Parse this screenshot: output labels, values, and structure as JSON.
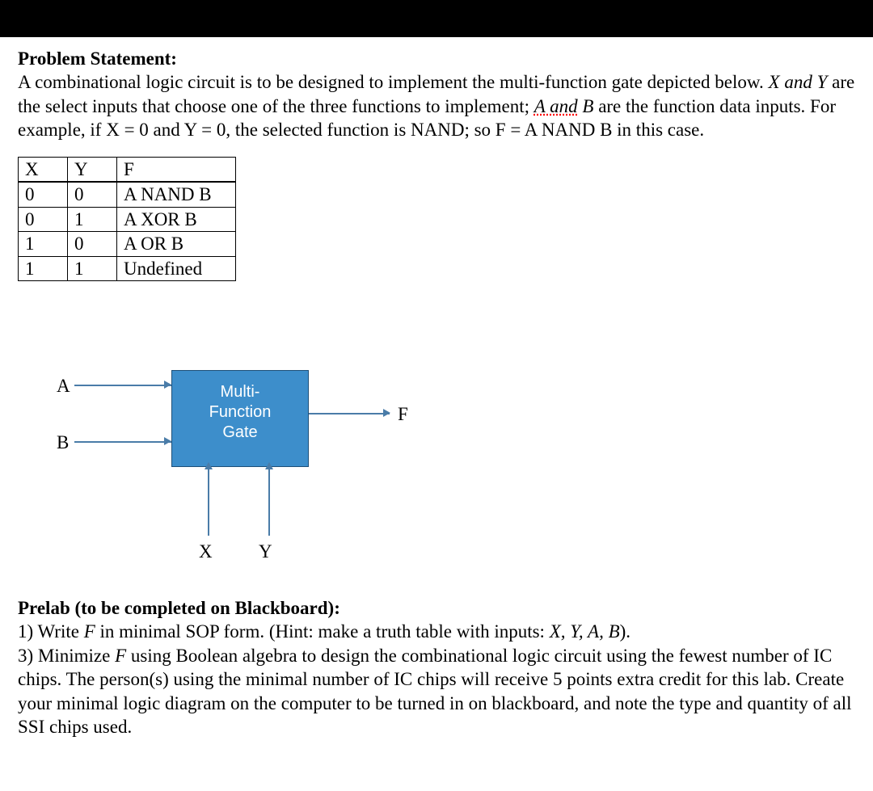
{
  "title": "Problem Statement:",
  "para_before_italic": "A combinational logic circuit is to be designed to implement the multi-function gate depicted below. ",
  "x_and_y": "X and Y",
  "para_mid1": " are the select inputs that choose one of the three functions to implement; ",
  "a_and": "A and",
  "para_mid2": " ",
  "b_italic": "B",
  "para_mid3": " are the function data inputs. For example, if X = 0 and Y = 0, the selected function is NAND; so F = A NAND B in this case.",
  "table": {
    "headers": [
      "X",
      "Y",
      "F"
    ],
    "rows": [
      [
        "0",
        "0",
        "A NAND B"
      ],
      [
        "0",
        "1",
        "A XOR B"
      ],
      [
        "1",
        "0",
        "A OR B"
      ],
      [
        "1",
        "1",
        "Undefined"
      ]
    ]
  },
  "diagram": {
    "gate_line1": "Multi-",
    "gate_line2": "Function",
    "gate_line3": "Gate",
    "A": "A",
    "B": "B",
    "F": "F",
    "X": "X",
    "Y": "Y"
  },
  "prelab_title": "Prelab (to be completed on Blackboard):",
  "prelab_line1a": "1) Write ",
  "prelab_F": "F",
  "prelab_line1b": " in minimal SOP form. (Hint: make a truth table with inputs: ",
  "prelab_inputs": "X, Y, A, B",
  "prelab_line1c": ").",
  "prelab_line2a": "3) Minimize ",
  "prelab_line2b": " using Boolean algebra to design the combinational logic circuit using the fewest number of IC chips. The person(s) using the minimal number of IC chips will receive 5 points extra credit for this lab. Create your minimal logic diagram on the computer to be turned in on blackboard, and note the type and quantity of all SSI chips used."
}
